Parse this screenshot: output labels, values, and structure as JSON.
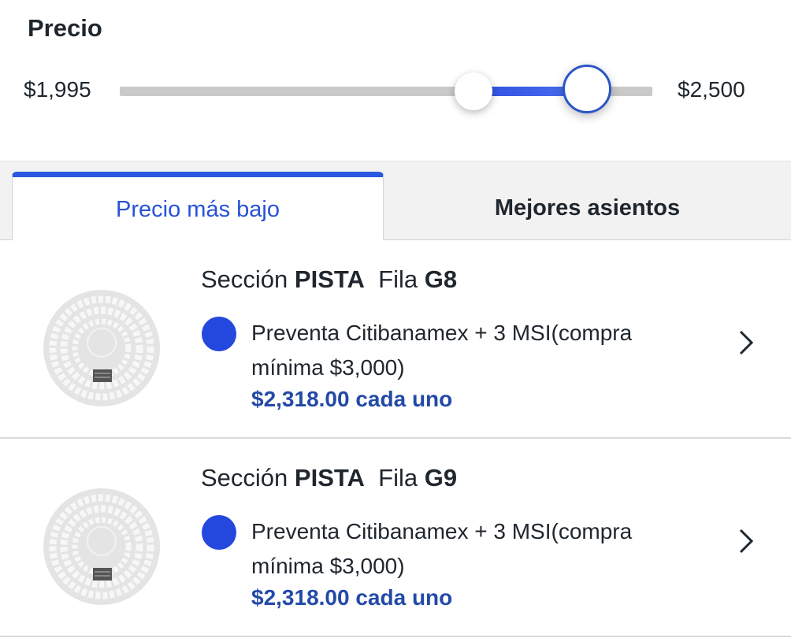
{
  "filter": {
    "title": "Precio",
    "min_label": "$1,995",
    "max_label": "$2,500",
    "range_fill_color": "#2f50e0"
  },
  "tabs": [
    {
      "label": "Precio más bajo",
      "active": true
    },
    {
      "label": "Mejores asientos",
      "active": false
    }
  ],
  "listings": [
    {
      "section_prefix": "Sección",
      "section": "PISTA",
      "row_prefix": "Fila",
      "row": "G8",
      "offer": "Preventa Citibanamex + 3 MSI(compra mínima $3,000)",
      "price": "$2,318.00 cada uno",
      "map_icon": "venue-map-icon",
      "action_icon": "chevron-right-icon"
    },
    {
      "section_prefix": "Sección",
      "section": "PISTA",
      "row_prefix": "Fila",
      "row": "G9",
      "offer": "Preventa Citibanamex + 3 MSI(compra mínima $3,000)",
      "price": "$2,318.00 cada uno",
      "map_icon": "venue-map-icon",
      "action_icon": "chevron-right-icon"
    }
  ],
  "colors": {
    "accent": "#2b58e0",
    "offer_dot": "#2447de",
    "price_text": "#234aa8"
  }
}
